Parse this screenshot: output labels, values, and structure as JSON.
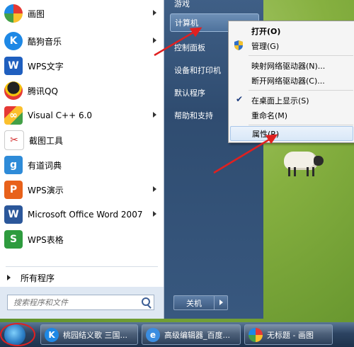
{
  "left_panel": {
    "items": [
      {
        "label": "画图",
        "icon": "paint-icon",
        "arrow": true
      },
      {
        "label": "酷狗音乐",
        "icon": "kugou-icon",
        "arrow": true
      },
      {
        "label": "WPS文字",
        "icon": "wps-writer-icon",
        "arrow": false
      },
      {
        "label": "腾讯QQ",
        "icon": "qq-penguin-icon",
        "arrow": false
      },
      {
        "label": "Visual C++ 6.0",
        "icon": "visual-cpp-icon",
        "arrow": true
      },
      {
        "label": "截图工具",
        "icon": "snipping-tool-icon",
        "arrow": false
      },
      {
        "label": "有道词典",
        "icon": "youdao-icon",
        "arrow": false
      },
      {
        "label": "WPS演示",
        "icon": "wps-presentation-icon",
        "arrow": true
      },
      {
        "label": "Microsoft Office Word 2007",
        "icon": "word-icon",
        "arrow": true
      },
      {
        "label": "WPS表格",
        "icon": "wps-spreadsheet-icon",
        "arrow": false
      }
    ],
    "all_programs": "所有程序",
    "search_placeholder": "搜索程序和文件"
  },
  "right_panel": {
    "items": [
      {
        "label": "游戏"
      },
      {
        "label": "计算机"
      },
      {
        "label": "控制面板"
      },
      {
        "label": "设备和打印机"
      },
      {
        "label": "默认程序"
      },
      {
        "label": "帮助和支持"
      }
    ],
    "shutdown": "关机"
  },
  "context_menu": {
    "items": [
      {
        "label": "打开(O)",
        "bold": true
      },
      {
        "label": "管理(G)",
        "icon": "uac-shield-icon"
      },
      {
        "label": "映射网络驱动器(N)..."
      },
      {
        "label": "断开网络驱动器(C)..."
      },
      {
        "label": "在桌面上显示(S)",
        "checked": true
      },
      {
        "label": "重命名(M)"
      },
      {
        "label": "属性(R)",
        "highlighted": true
      }
    ]
  },
  "taskbar": {
    "buttons": [
      {
        "label": "桃园结义歌 三国...",
        "icon": "kugou-icon"
      },
      {
        "label": "高级编辑器_百度...",
        "icon": "ie-icon"
      },
      {
        "label": "无标题 - 画图",
        "icon": "paint-icon"
      }
    ]
  },
  "colors": {
    "start_right_panel": "#2f4c70",
    "annotation_red": "#e02020",
    "menu_highlight": "#d9e8f8"
  }
}
